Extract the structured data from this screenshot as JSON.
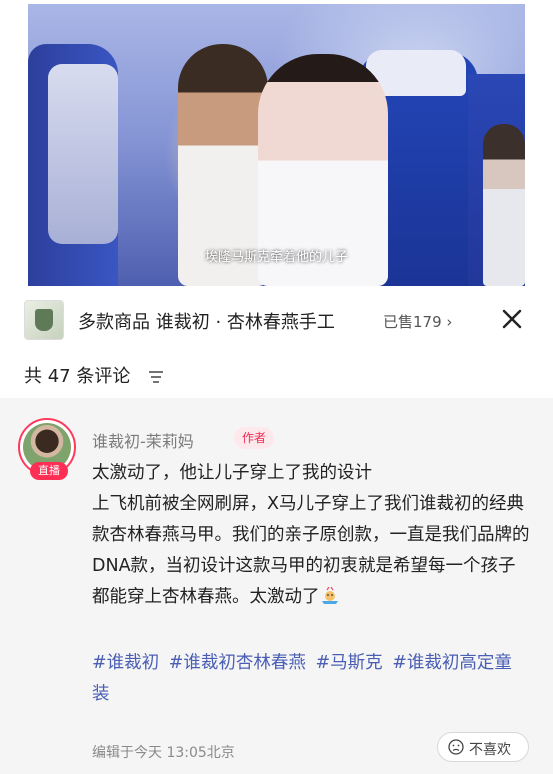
{
  "video": {
    "subtitle": "埃隆马斯克牵着他的儿子"
  },
  "product": {
    "title": "多款商品 谁裁初 · 杏林春燕手工",
    "sold": "已售179 ›",
    "thumbnail_icon": "clothing-thumbnail",
    "close_icon": "close-icon"
  },
  "comments_header": {
    "count_label": "共 47 条评论",
    "sort_icon": "sort-lines-icon"
  },
  "comment": {
    "user": "谁裁初-茉莉妈",
    "author_tag": "作者",
    "live_badge": "直播",
    "lines": [
      "太激动了，他让儿子穿上了我的设计",
      "上飞机前被全网刷屏，X马儿子穿上了我们谁裁初的经典款杏林春燕马甲。我们的亲子原创款，一直是我们品牌的DNA款，当初设计这款马甲的初衷就是希望每一个孩子都能穿上杏林春燕。太激动了"
    ],
    "emoji_icon": "celebration-emoji-icon",
    "hashtags": [
      "#谁裁初",
      "#谁裁初杏林春燕",
      "#马斯克",
      "#谁裁初高定童装"
    ],
    "meta": "编辑于今天 13:05北京",
    "dislike_label": "不喜欢"
  },
  "colors": {
    "accent_red": "#ff2e55",
    "hashtag_blue": "#4a5fb4",
    "sheet_bg": "#f5f5f5"
  }
}
